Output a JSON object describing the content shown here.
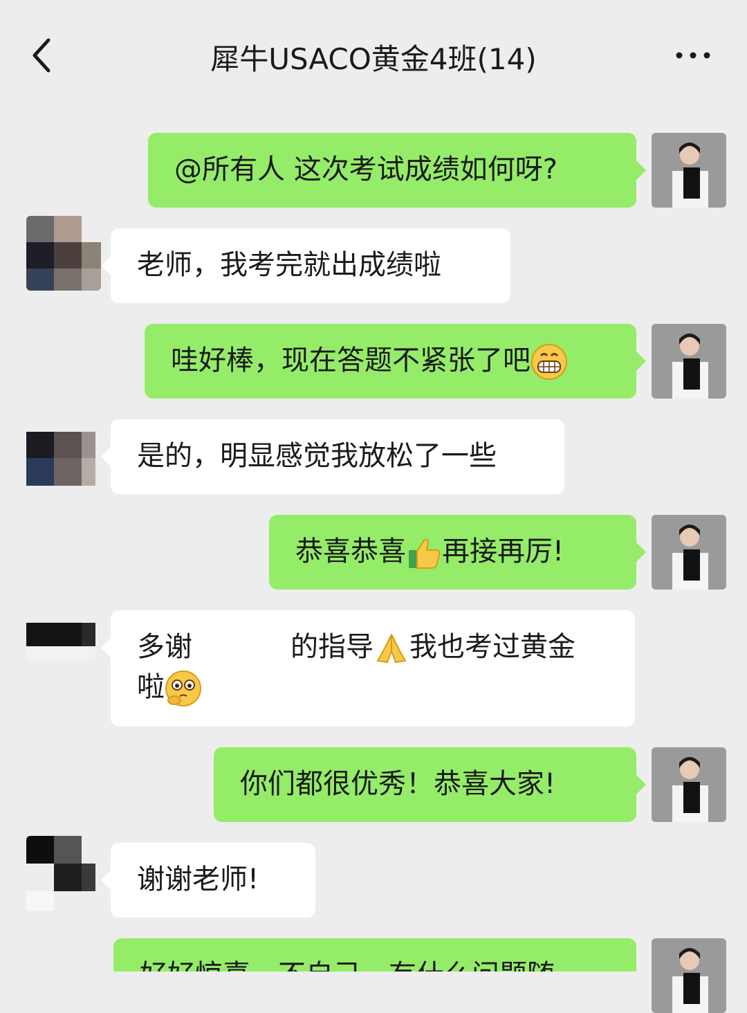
{
  "header": {
    "title": "犀牛USACO黄金4班(14)",
    "back_icon": "chevron-left-icon",
    "more_icon": "more-horizontal-icon"
  },
  "messages": [
    {
      "sender": "me",
      "text": "@所有人 这次考试成绩如何呀?"
    },
    {
      "sender": "other",
      "text": "老师，我考完就出成绩啦"
    },
    {
      "sender": "me",
      "text": "哇好棒，现在答题不紧张了吧",
      "emoji_after": "grinning-face-emoji"
    },
    {
      "sender": "other",
      "text": "是的，明显感觉我放松了一些"
    },
    {
      "sender": "me",
      "text_before": "恭喜恭喜",
      "emoji": "thumbs-up-emoji",
      "text_after": "再接再厉!"
    },
    {
      "sender": "other",
      "line1_a": "多谢",
      "line1_b": "的指导",
      "emoji1": "folded-hands-emoji",
      "line1_c": "我也考过黄金",
      "line2": "啦",
      "emoji2": "shy-face-emoji"
    },
    {
      "sender": "me",
      "text": "你们都很优秀！恭喜大家!"
    },
    {
      "sender": "other",
      "text": "谢谢老师!"
    },
    {
      "sender": "me",
      "text": "好好惊喜，不自己，有什么问题随"
    }
  ],
  "colors": {
    "background": "#ededed",
    "my_bubble": "#95ec69",
    "other_bubble": "#ffffff"
  }
}
